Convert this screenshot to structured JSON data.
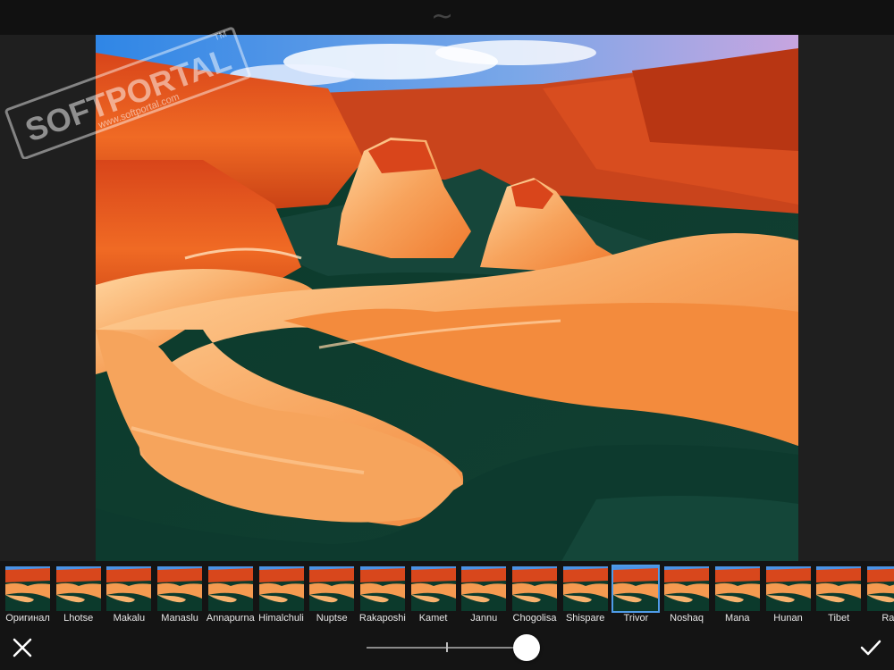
{
  "header": {
    "drag_handle_glyph": "~"
  },
  "photo": {
    "subject": "canyon-river-photo"
  },
  "watermark": {
    "brand": "SOFTPORTAL",
    "url": "www.softportal.com",
    "mark": "TM"
  },
  "filters": [
    {
      "label": "Оригинал",
      "selected": false
    },
    {
      "label": "Lhotse",
      "selected": false
    },
    {
      "label": "Makalu",
      "selected": false
    },
    {
      "label": "Manaslu",
      "selected": false
    },
    {
      "label": "Annapurna",
      "selected": false
    },
    {
      "label": "Himalchuli",
      "selected": false
    },
    {
      "label": "Nuptse",
      "selected": false
    },
    {
      "label": "Rakaposhi",
      "selected": false
    },
    {
      "label": "Kamet",
      "selected": false
    },
    {
      "label": "Jannu",
      "selected": false
    },
    {
      "label": "Chogolisa",
      "selected": false
    },
    {
      "label": "Shispare",
      "selected": false
    },
    {
      "label": "Trivor",
      "selected": true
    },
    {
      "label": "Noshaq",
      "selected": false
    },
    {
      "label": "Mana",
      "selected": false
    },
    {
      "label": "Hunan",
      "selected": false
    },
    {
      "label": "Tibet",
      "selected": false
    },
    {
      "label": "Rat",
      "selected": false
    }
  ],
  "controls": {
    "cancel_icon": "close-icon",
    "confirm_icon": "checkmark-icon",
    "intensity_value": 1.0
  },
  "colors": {
    "selected_border": "#4f9be8",
    "background": "#1f1f1f",
    "bar": "#141414"
  }
}
